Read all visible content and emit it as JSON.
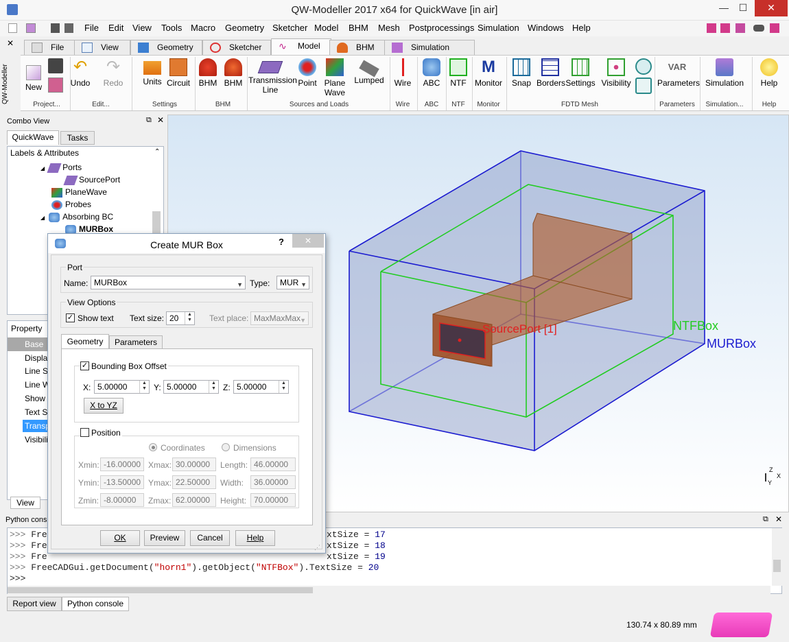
{
  "window": {
    "title": "QW-Modeller 2017 x64 for QuickWave [in air]",
    "min": "—",
    "max": "☐",
    "close": "✕"
  },
  "menu": [
    "File",
    "Edit",
    "View",
    "Tools",
    "Macro",
    "Geometry",
    "Sketcher",
    "Model",
    "BHM",
    "Mesh",
    "Postprocessings",
    "Simulation",
    "Windows",
    "Help"
  ],
  "workbench_tabs": [
    "File",
    "View",
    "Geometry",
    "Sketcher",
    "Model",
    "BHM",
    "Simulation"
  ],
  "ribbon": {
    "new": "New",
    "project": "Project...",
    "undo": "Undo",
    "redo": "Redo",
    "edit": "Edit...",
    "units": "Units",
    "circuit": "Circuit",
    "settings_grp": "Settings",
    "bhm1": "BHM",
    "bhm2": "BHM",
    "bhm_grp": "BHM",
    "tline": "Transmission\nLine",
    "point": "Point",
    "plane": "Plane\nWave",
    "lumped": "Lumped",
    "sources_grp": "Sources and Loads",
    "wire": "Wire",
    "wire_grp": "Wire",
    "abc": "ABC",
    "abc_grp": "ABC",
    "ntf": "NTF",
    "ntf_grp": "NTF",
    "monitor": "Monitor",
    "monitor_grp": "Monitor",
    "snap": "Snap",
    "borders": "Borders",
    "msettings": "Settings",
    "visibility": "Visibility",
    "fdtd_grp": "FDTD Mesh",
    "var": "VAR",
    "parameters": "Parameters",
    "parameters_grp": "Parameters",
    "simulation": "Simulation",
    "simulation_grp": "Simulation...",
    "help": "Help",
    "help_grp": "Help"
  },
  "left_vertical": "QW-Modeller",
  "combo": {
    "title": "Combo View",
    "tabs": [
      "QuickWave",
      "Tasks"
    ],
    "tree_header": "Labels & Attributes",
    "tree": [
      "Ports",
      "SourcePort",
      "PlaneWave",
      "Probes",
      "Absorbing BC",
      "MURBox"
    ]
  },
  "property": {
    "header": "Property",
    "rows": [
      "Base",
      "Display",
      "Line St",
      "Line W",
      "Show T",
      "Text Si",
      "Transp",
      "Visibili"
    ],
    "tab": "View"
  },
  "viewport_labels": {
    "source": "SourcePort [1]",
    "ntf": "NTFBox",
    "mur": "MURBox",
    "axis_z": "Z",
    "axis_x": "X",
    "axis_y": "Y"
  },
  "dialog": {
    "title": "Create MUR Box",
    "help": "?",
    "close": "✕",
    "port_group": "Port",
    "name_label": "Name:",
    "name_value": "MURBox",
    "type_label": "Type:",
    "type_value": "MUR",
    "view_group": "View Options",
    "show_text": "Show text",
    "text_size_label": "Text size:",
    "text_size": "20",
    "text_place_label": "Text place:",
    "text_place": "MaxMaxMax",
    "tabs": [
      "Geometry",
      "Parameters"
    ],
    "bbox_offset": "Bounding Box Offset",
    "x_label": "X:",
    "x": "5.00000",
    "y_label": "Y:",
    "y": "5.00000",
    "z_label": "Z:",
    "z": "5.00000",
    "x_to_yz": "X to YZ",
    "position": "Position",
    "coords": "Coordinates",
    "dims": "Dimensions",
    "xmin_l": "Xmin:",
    "xmin": "-16.00000",
    "xmax_l": "Xmax:",
    "xmax": "30.00000",
    "length_l": "Length:",
    "length": "46.00000",
    "ymin_l": "Ymin:",
    "ymin": "-13.50000",
    "ymax_l": "Ymax:",
    "ymax": "22.50000",
    "width_l": "Width:",
    "width": "36.00000",
    "zmin_l": "Zmin:",
    "zmin": "-8.00000",
    "zmax_l": "Zmax:",
    "zmax": "62.00000",
    "height_l": "Height:",
    "height": "70.00000",
    "ok": "OK",
    "preview": "Preview",
    "cancel": "Cancel",
    "help_btn": "Help"
  },
  "python": {
    "title": "Python console",
    "lines": [
      {
        "prompt": ">>> ",
        "code": "Fre",
        "tail": "xtSize = ",
        "num": "17"
      },
      {
        "prompt": ">>> ",
        "code": "Fre",
        "tail": "xtSize = ",
        "num": "18"
      },
      {
        "prompt": ">>> ",
        "code": "Fre",
        "tail": "xtSize = ",
        "num": "19"
      }
    ],
    "last_a": "FreeCADGui.getDocument(",
    "last_s1": "\"horn1\"",
    "last_b": ").getObject(",
    "last_s2": "\"NTFBox\"",
    "last_c": ").TextSize = ",
    "last_n": "20",
    "empty_prompt": ">>>"
  },
  "bottom_tabs": [
    "Report view",
    "Python console"
  ],
  "status": {
    "dims": "130.74 x 80.89 mm"
  },
  "colors": {
    "mur": "#1b1bd0",
    "ntf": "#22cc22",
    "horn": "#b06030",
    "source": "#e02020"
  }
}
